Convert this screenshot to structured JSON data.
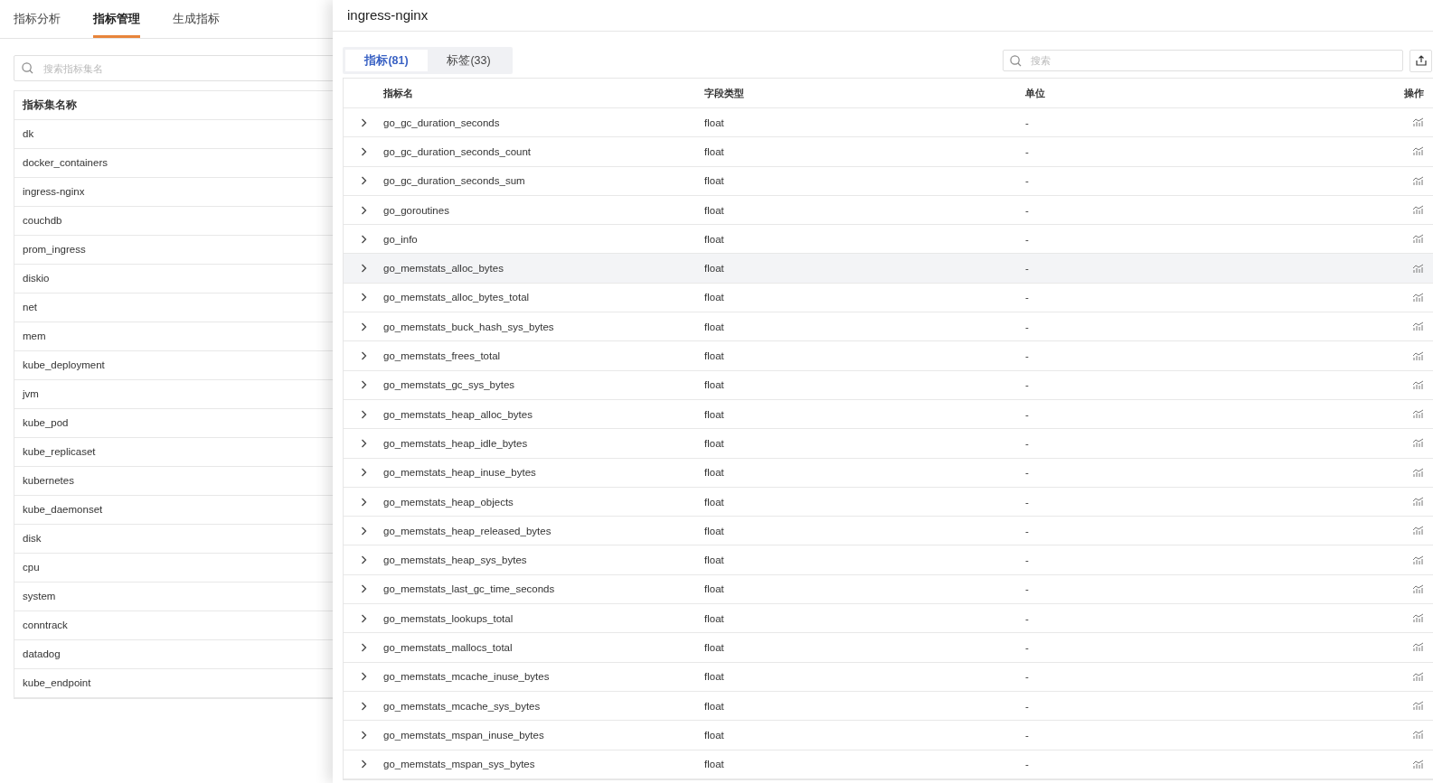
{
  "nav_tabs": [
    {
      "label": "指标分析",
      "selected": false
    },
    {
      "label": "指标管理",
      "selected": true
    },
    {
      "label": "生成指标",
      "selected": false
    }
  ],
  "measurement_search": {
    "placeholder": "搜索指标集名"
  },
  "measurement_table": {
    "column": "指标集名称",
    "rows": [
      "dk",
      "docker_containers",
      "ingress-nginx",
      "couchdb",
      "prom_ingress",
      "diskio",
      "net",
      "mem",
      "kube_deployment",
      "jvm",
      "kube_pod",
      "kube_replicaset",
      "kubernetes",
      "kube_daemonset",
      "disk",
      "cpu",
      "system",
      "conntrack",
      "datadog",
      "kube_endpoint"
    ]
  },
  "drawer": {
    "title": "ingress-nginx",
    "tabs": [
      {
        "label": "指标(81)",
        "selected": true
      },
      {
        "label": "标签(33)",
        "selected": false
      }
    ],
    "search": {
      "placeholder": "搜索"
    },
    "table": {
      "columns": [
        "指标名",
        "字段类型",
        "单位",
        "操作"
      ],
      "rows": [
        {
          "name": "go_gc_duration_seconds",
          "type": "float",
          "unit": "-",
          "highlighted": false
        },
        {
          "name": "go_gc_duration_seconds_count",
          "type": "float",
          "unit": "-",
          "highlighted": false
        },
        {
          "name": "go_gc_duration_seconds_sum",
          "type": "float",
          "unit": "-",
          "highlighted": false
        },
        {
          "name": "go_goroutines",
          "type": "float",
          "unit": "-",
          "highlighted": false
        },
        {
          "name": "go_info",
          "type": "float",
          "unit": "-",
          "highlighted": false
        },
        {
          "name": "go_memstats_alloc_bytes",
          "type": "float",
          "unit": "-",
          "highlighted": true
        },
        {
          "name": "go_memstats_alloc_bytes_total",
          "type": "float",
          "unit": "-",
          "highlighted": false
        },
        {
          "name": "go_memstats_buck_hash_sys_bytes",
          "type": "float",
          "unit": "-",
          "highlighted": false
        },
        {
          "name": "go_memstats_frees_total",
          "type": "float",
          "unit": "-",
          "highlighted": false
        },
        {
          "name": "go_memstats_gc_sys_bytes",
          "type": "float",
          "unit": "-",
          "highlighted": false
        },
        {
          "name": "go_memstats_heap_alloc_bytes",
          "type": "float",
          "unit": "-",
          "highlighted": false
        },
        {
          "name": "go_memstats_heap_idle_bytes",
          "type": "float",
          "unit": "-",
          "highlighted": false
        },
        {
          "name": "go_memstats_heap_inuse_bytes",
          "type": "float",
          "unit": "-",
          "highlighted": false
        },
        {
          "name": "go_memstats_heap_objects",
          "type": "float",
          "unit": "-",
          "highlighted": false
        },
        {
          "name": "go_memstats_heap_released_bytes",
          "type": "float",
          "unit": "-",
          "highlighted": false
        },
        {
          "name": "go_memstats_heap_sys_bytes",
          "type": "float",
          "unit": "-",
          "highlighted": false
        },
        {
          "name": "go_memstats_last_gc_time_seconds",
          "type": "float",
          "unit": "-",
          "highlighted": false
        },
        {
          "name": "go_memstats_lookups_total",
          "type": "float",
          "unit": "-",
          "highlighted": false
        },
        {
          "name": "go_memstats_mallocs_total",
          "type": "float",
          "unit": "-",
          "highlighted": false
        },
        {
          "name": "go_memstats_mcache_inuse_bytes",
          "type": "float",
          "unit": "-",
          "highlighted": false
        },
        {
          "name": "go_memstats_mcache_sys_bytes",
          "type": "float",
          "unit": "-",
          "highlighted": false
        },
        {
          "name": "go_memstats_mspan_inuse_bytes",
          "type": "float",
          "unit": "-",
          "highlighted": false
        },
        {
          "name": "go_memstats_mspan_sys_bytes",
          "type": "float",
          "unit": "-",
          "highlighted": false
        }
      ]
    }
  }
}
